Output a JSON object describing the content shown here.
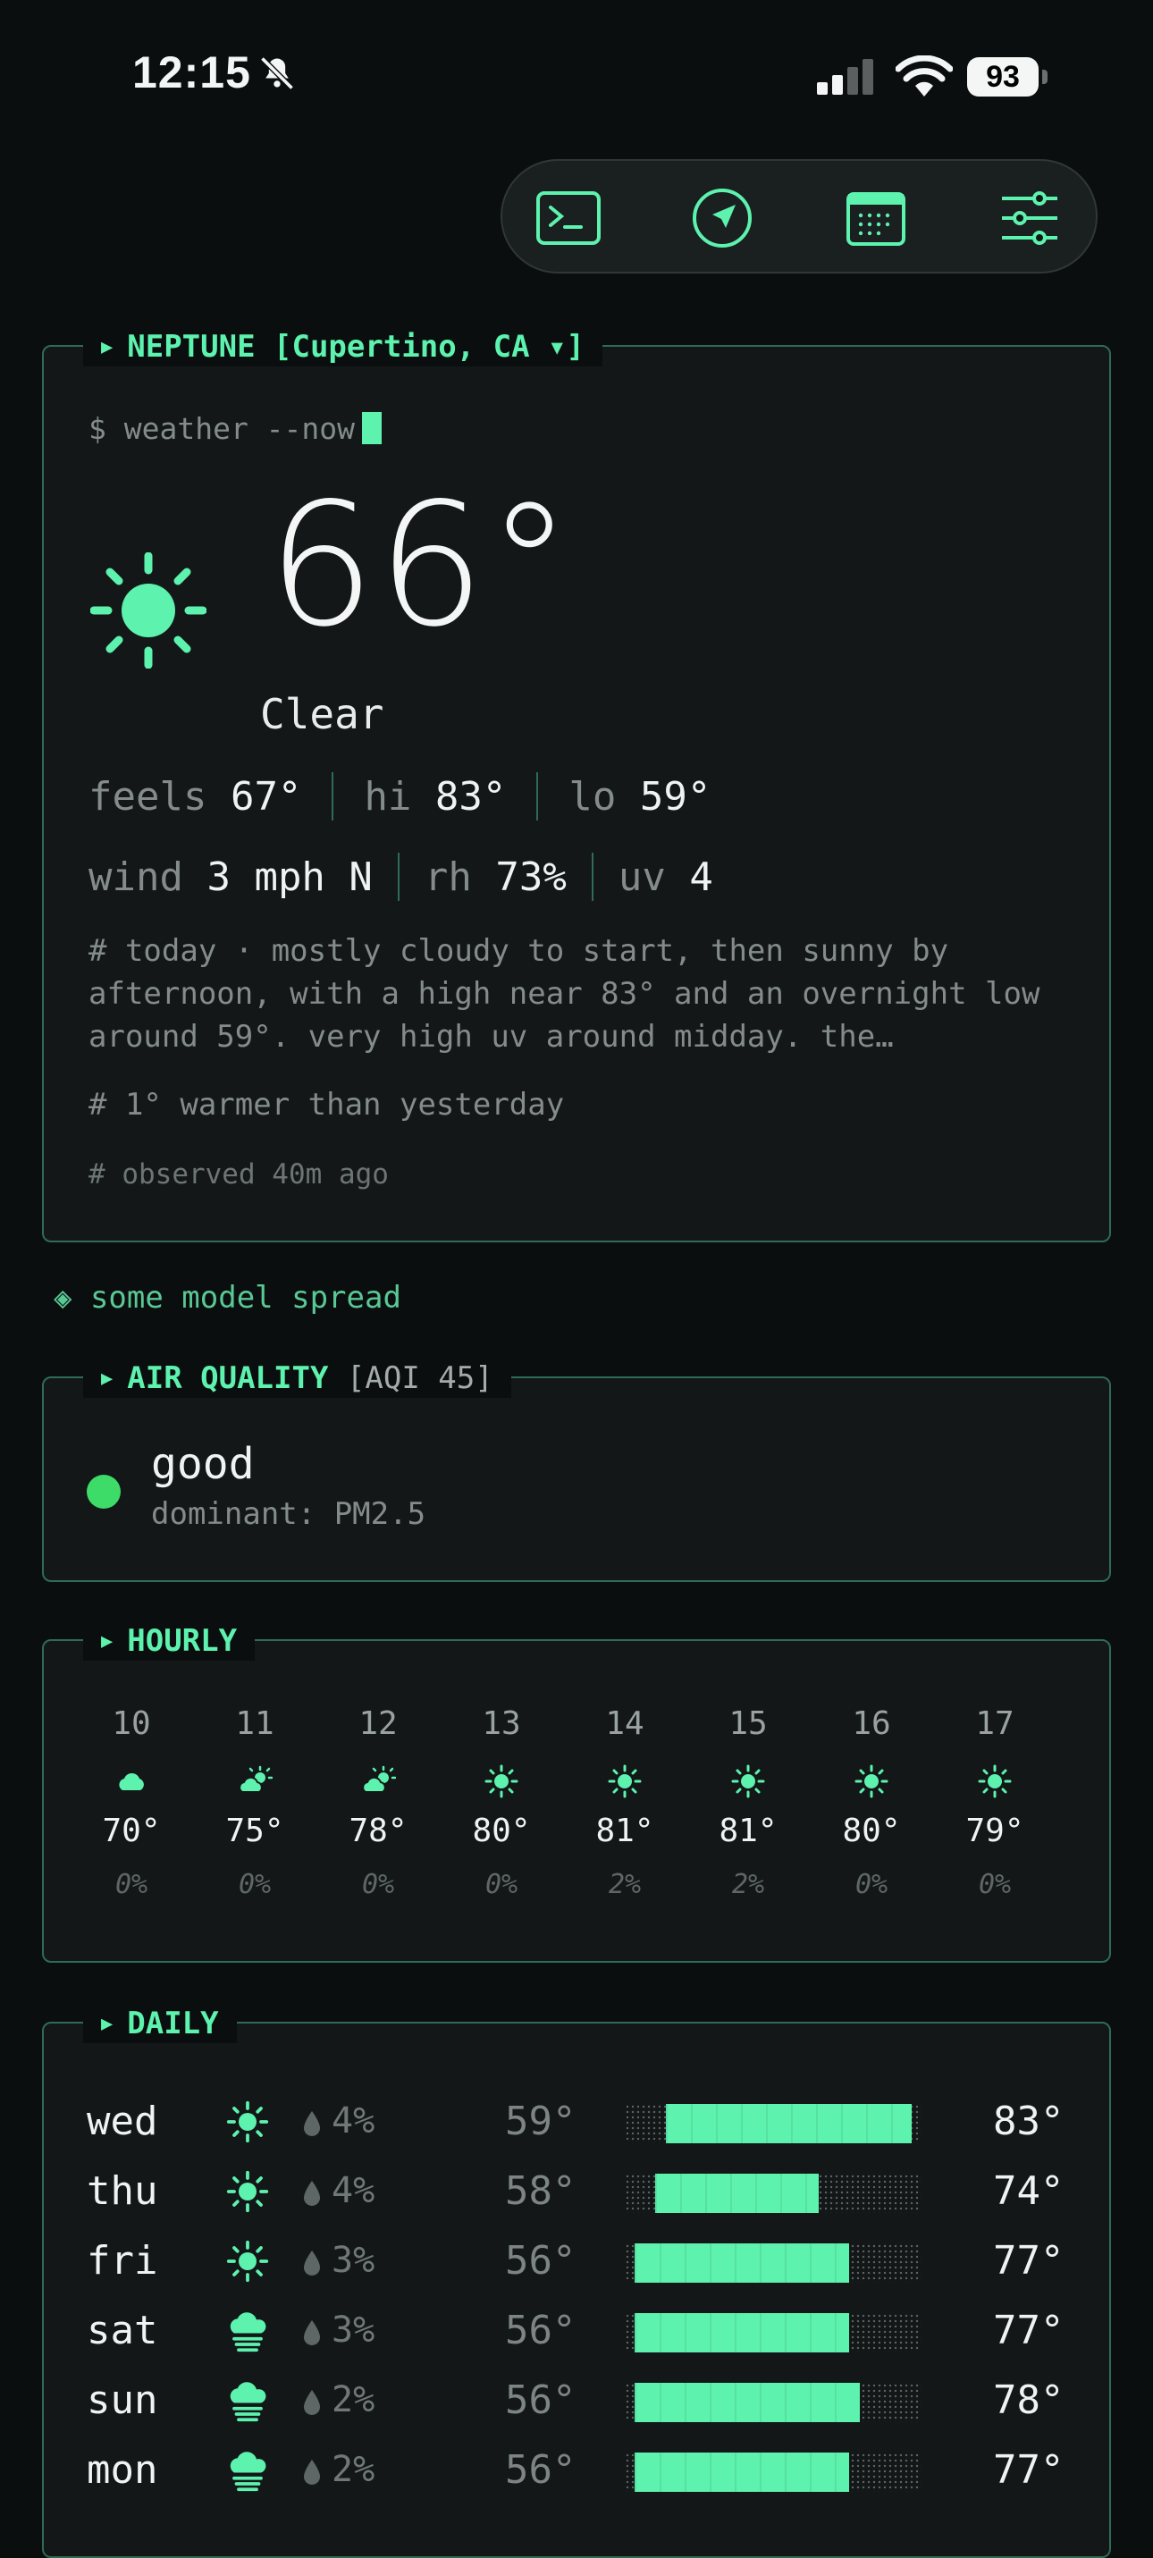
{
  "status_bar": {
    "time": "12:15",
    "battery": "93"
  },
  "toolbar": {
    "icons": [
      "terminal-icon",
      "location-arrow-icon",
      "calendar-icon",
      "sliders-icon"
    ]
  },
  "current": {
    "panel_title": "NEPTUNE [Cupertino, CA ▾]",
    "command": "$ weather --now",
    "temperature": "66°",
    "condition": "Clear",
    "feels_label": "feels",
    "feels_value": "67°",
    "hi_label": "hi",
    "hi_value": "83°",
    "lo_label": "lo",
    "lo_value": "59°",
    "wind_label": "wind",
    "wind_value": "3 mph N",
    "rh_label": "rh",
    "rh_value": "73%",
    "uv_label": "uv",
    "uv_value": "4",
    "description": "# today · mostly cloudy to start, then sunny by afternoon, with a high near 83° and an overnight low around 59°. very high uv around midday. the…",
    "comparison": "# 1° warmer than yesterday",
    "observed": "# observed 40m ago"
  },
  "model_spread": "◈ some model spread",
  "air_quality": {
    "title": "AIR QUALITY",
    "aqi_label": "[AQI 45]",
    "status": "good",
    "dominant": "dominant: PM2.5",
    "dot_color": "#3ddc68"
  },
  "hourly": {
    "title": "HOURLY",
    "hours": [
      {
        "hour": "10",
        "icon": "cloud-icon",
        "temp": "70°",
        "precip": "0%"
      },
      {
        "hour": "11",
        "icon": "partly-sunny-icon",
        "temp": "75°",
        "precip": "0%"
      },
      {
        "hour": "12",
        "icon": "partly-sunny-icon",
        "temp": "78°",
        "precip": "0%"
      },
      {
        "hour": "13",
        "icon": "sun-icon",
        "temp": "80°",
        "precip": "0%"
      },
      {
        "hour": "14",
        "icon": "sun-icon",
        "temp": "81°",
        "precip": "2%"
      },
      {
        "hour": "15",
        "icon": "sun-icon",
        "temp": "81°",
        "precip": "2%"
      },
      {
        "hour": "16",
        "icon": "sun-icon",
        "temp": "80°",
        "precip": "0%"
      },
      {
        "hour": "17",
        "icon": "sun-icon",
        "temp": "79°",
        "precip": "0%"
      }
    ]
  },
  "daily": {
    "title": "DAILY",
    "range_min": 55,
    "range_max": 84,
    "days": [
      {
        "day": "wed",
        "icon": "sun-icon",
        "precip": "4%",
        "lo": "59°",
        "hi": "83°",
        "lo_val": 59,
        "hi_val": 83
      },
      {
        "day": "thu",
        "icon": "sun-icon",
        "precip": "4%",
        "lo": "58°",
        "hi": "74°",
        "lo_val": 58,
        "hi_val": 74
      },
      {
        "day": "fri",
        "icon": "sun-icon",
        "precip": "3%",
        "lo": "56°",
        "hi": "77°",
        "lo_val": 56,
        "hi_val": 77
      },
      {
        "day": "sat",
        "icon": "fog-icon",
        "precip": "3%",
        "lo": "56°",
        "hi": "77°",
        "lo_val": 56,
        "hi_val": 77
      },
      {
        "day": "sun",
        "icon": "fog-icon",
        "precip": "2%",
        "lo": "56°",
        "hi": "78°",
        "lo_val": 56,
        "hi_val": 78
      },
      {
        "day": "mon",
        "icon": "fog-icon",
        "precip": "2%",
        "lo": "56°",
        "hi": "77°",
        "lo_val": 56,
        "hi_val": 77
      }
    ]
  }
}
